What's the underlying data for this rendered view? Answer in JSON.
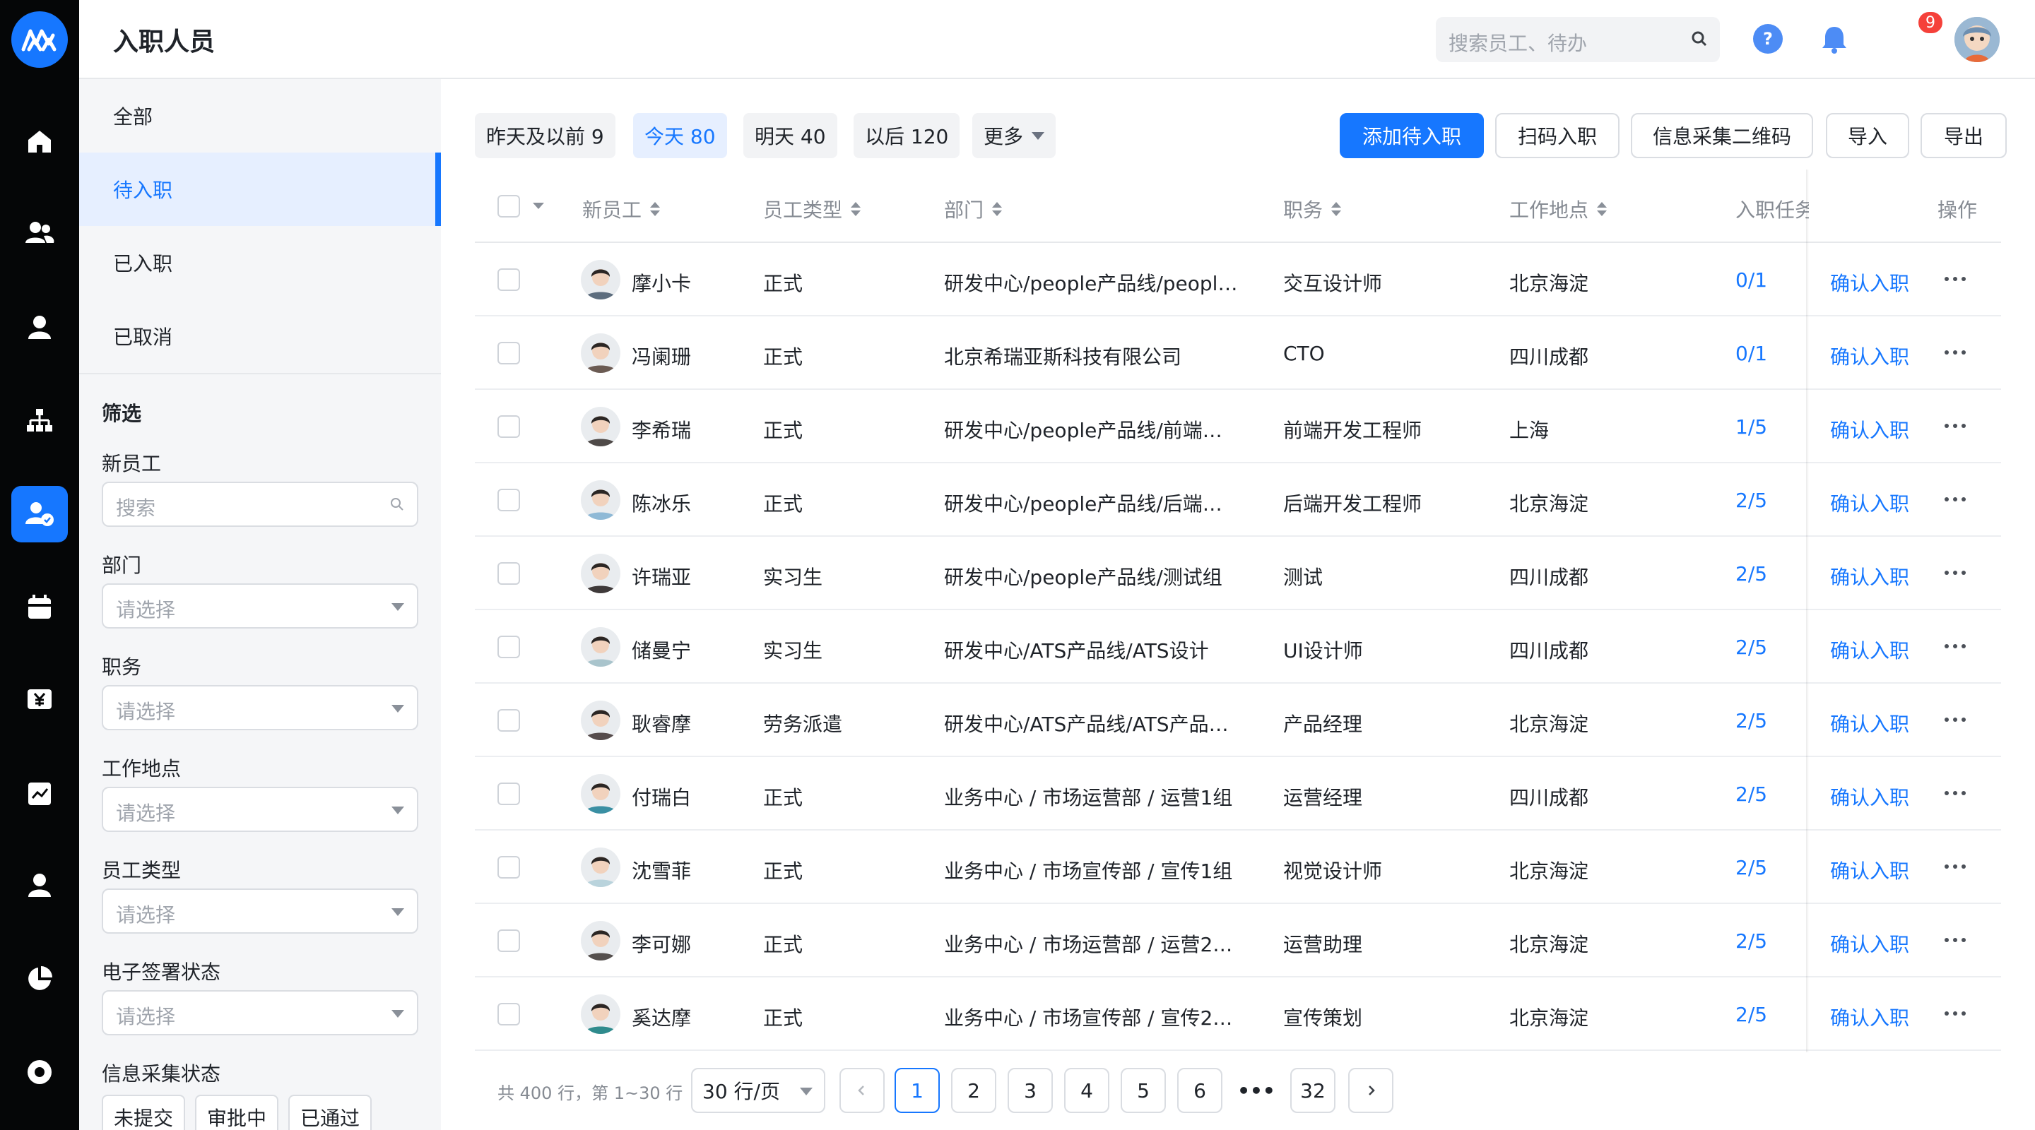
{
  "header": {
    "title": "入职人员",
    "search_placeholder": "搜索员工、待办",
    "notification_count": "9",
    "help_label": "?"
  },
  "rail": {
    "icons": [
      "logo-icon",
      "home-icon",
      "people-icon",
      "person-icon",
      "org-chart-icon",
      "onboarding-icon",
      "calendar-icon",
      "salary-icon",
      "report-icon",
      "profile-icon",
      "pie-chart-icon",
      "settings-icon"
    ],
    "active": "onboarding-icon",
    "accent": "#1677ff"
  },
  "sidebar": {
    "tabs": [
      {
        "label": "全部"
      },
      {
        "label": "待入职"
      },
      {
        "label": "已入职"
      },
      {
        "label": "已取消"
      }
    ],
    "active_tab": "待入职",
    "filter_title": "筛选",
    "filters": {
      "new_employee": {
        "label": "新员工",
        "placeholder": "搜索"
      },
      "department": {
        "label": "部门",
        "placeholder": "请选择"
      },
      "position": {
        "label": "职务",
        "placeholder": "请选择"
      },
      "location": {
        "label": "工作地点",
        "placeholder": "请选择"
      },
      "employee_type": {
        "label": "员工类型",
        "placeholder": "请选择"
      },
      "esign_status": {
        "label": "电子签署状态",
        "placeholder": "请选择"
      },
      "info_status": {
        "label": "信息采集状态",
        "chips": [
          "未提交",
          "审批中",
          "已通过"
        ]
      }
    }
  },
  "toolbar": {
    "date_tabs": [
      "昨天及以前 9",
      "今天 80",
      "明天 40",
      "以后 120"
    ],
    "active_date_tab": "今天 80",
    "more_label": "更多",
    "buttons": {
      "add": "添加待入职",
      "scan": "扫码入职",
      "qrcode": "信息采集二维码",
      "import": "导入",
      "export": "导出"
    }
  },
  "table": {
    "columns": {
      "name": "新员工",
      "type": "员工类型",
      "dept": "部门",
      "position": "职务",
      "location": "工作地点",
      "tasks": "入职任务",
      "actions": "操作"
    },
    "action_label": "确认入职",
    "rows": [
      {
        "name": "摩小卡",
        "type": "正式",
        "dept": "研发中心/people产品线/peopl…",
        "position": "交互设计师",
        "location": "北京海淀",
        "tasks": "0/1",
        "avatar_color": "#5d6d7e"
      },
      {
        "name": "冯阑珊",
        "type": "正式",
        "dept": "北京希瑞亚斯科技有限公司",
        "position": "CTO",
        "location": "四川成都",
        "tasks": "0/1",
        "avatar_color": "#6b5b53"
      },
      {
        "name": "李希瑞",
        "type": "正式",
        "dept": "研发中心/people产品线/前端…",
        "position": "前端开发工程师",
        "location": "上海",
        "tasks": "1/5",
        "avatar_color": "#4f4a48"
      },
      {
        "name": "陈冰乐",
        "type": "正式",
        "dept": "研发中心/people产品线/后端…",
        "position": "后端开发工程师",
        "location": "北京海淀",
        "tasks": "2/5",
        "avatar_color": "#8fb9d6"
      },
      {
        "name": "许瑞亚",
        "type": "实习生",
        "dept": "研发中心/people产品线/测试组",
        "position": "测试",
        "location": "四川成都",
        "tasks": "2/5",
        "avatar_color": "#3f3a3a"
      },
      {
        "name": "储曼宁",
        "type": "实习生",
        "dept": "研发中心/ATS产品线/ATS设计",
        "position": "UI设计师",
        "location": "四川成都",
        "tasks": "2/5",
        "avatar_color": "#a9c4cc"
      },
      {
        "name": "耿睿摩",
        "type": "劳务派遣",
        "dept": "研发中心/ATS产品线/ATS产品…",
        "position": "产品经理",
        "location": "北京海淀",
        "tasks": "2/5",
        "avatar_color": "#564c4c"
      },
      {
        "name": "付瑞白",
        "type": "正式",
        "dept": "业务中心 / 市场运营部 / 运营1组",
        "position": "运营经理",
        "location": "四川成都",
        "tasks": "2/5",
        "avatar_color": "#3a8fa3"
      },
      {
        "name": "沈雪菲",
        "type": "正式",
        "dept": "业务中心 / 市场宣传部 / 宣传1组",
        "position": "视觉设计师",
        "location": "北京海淀",
        "tasks": "2/5",
        "avatar_color": "#b9d3dc"
      },
      {
        "name": "李可娜",
        "type": "正式",
        "dept": "业务中心 / 市场运营部 / 运营2…",
        "position": "运营助理",
        "location": "北京海淀",
        "tasks": "2/5",
        "avatar_color": "#55504e"
      },
      {
        "name": "奚达摩",
        "type": "正式",
        "dept": "业务中心 / 市场宣传部 / 宣传2…",
        "position": "宣传策划",
        "location": "北京海淀",
        "tasks": "2/5",
        "avatar_color": "#2f8b8d"
      }
    ]
  },
  "pagination": {
    "total_text": "共 400 行，第 1~30 行",
    "page_size": "30 行/页",
    "pages": [
      "1",
      "2",
      "3",
      "4",
      "5",
      "6",
      "•••",
      "32"
    ],
    "current": "1"
  }
}
